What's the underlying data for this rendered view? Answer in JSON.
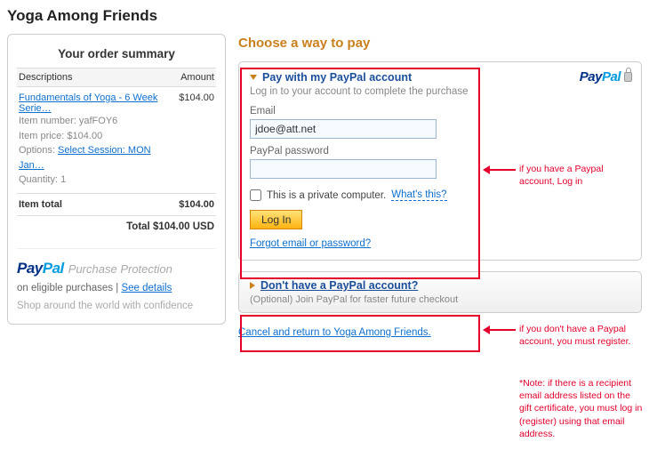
{
  "page": {
    "title": "Yoga Among Friends"
  },
  "summary": {
    "heading": "Your order summary",
    "col_desc": "Descriptions",
    "col_amount": "Amount",
    "item": {
      "name": "Fundamentals of Yoga - 6 Week Serie…",
      "amount": "$104.00",
      "number_label": "Item number:",
      "number_value": "yafFOY6",
      "price_label": "Item price:",
      "price_value": "$104.00",
      "options_label": "Options:",
      "options_value": "Select Session: MON Jan…",
      "qty_label": "Quantity:",
      "qty_value": "1"
    },
    "item_total_label": "Item total",
    "item_total_value": "$104.00",
    "grand_total": "Total $104.00 USD",
    "protection_label": "Purchase Protection",
    "protection_sub_prefix": "on eligible purchases |",
    "see_details": "See details",
    "protection_sub2": "Shop around the world with confidence"
  },
  "right": {
    "choose_title": "Choose a way to pay",
    "paypal_open": {
      "title": "Pay with my PayPal account",
      "subtitle": "Log in to your account to complete the purchase",
      "email_label": "Email",
      "email_value": "jdoe@att.net",
      "password_label": "PayPal password",
      "private_label": "This is a private computer.",
      "whats_this": "What's this?",
      "login_btn": "Log In",
      "forgot": "Forgot email or password?"
    },
    "no_account": {
      "title": "Don't have a PayPal account?",
      "subtitle": "(Optional) Join PayPal for faster future checkout"
    },
    "cancel_link": "Cancel and return to Yoga Among Friends."
  },
  "annotations": {
    "login_hint": "if you have a Paypal account, Log in",
    "register_hint": "if you don't have a Paypal account, you must register.",
    "note": "*Note: if there is a recipient email address listed on the gift certificate, you must log in (register) using that email address."
  }
}
